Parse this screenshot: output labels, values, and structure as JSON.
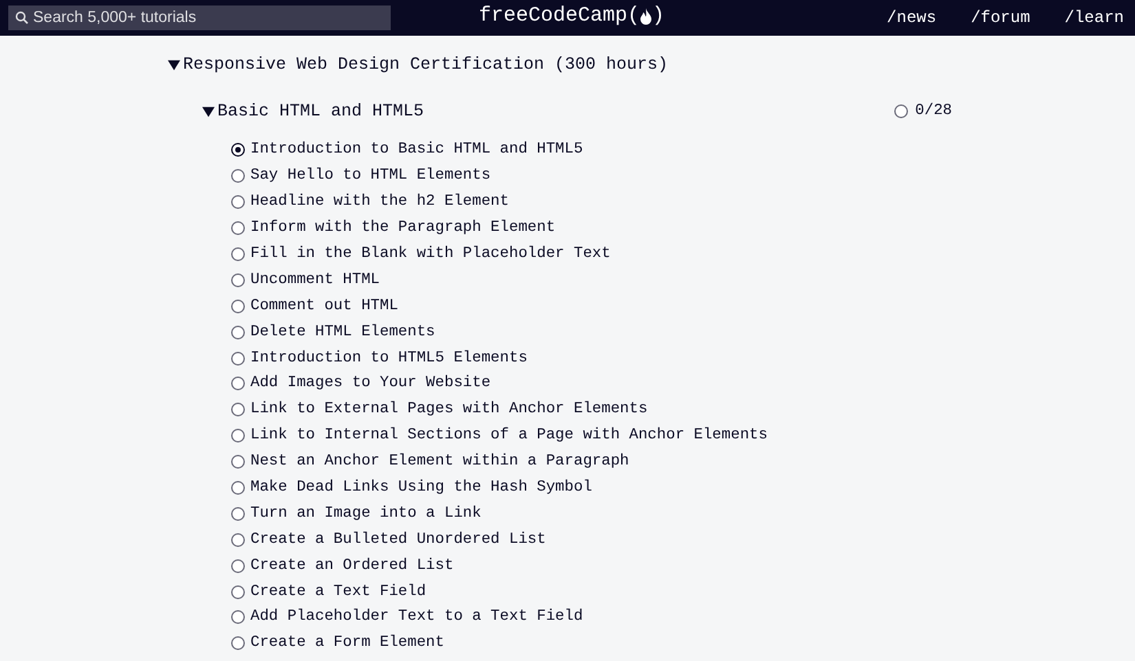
{
  "header": {
    "search": {
      "placeholder": "Search 5,000+ tutorials"
    },
    "logo": {
      "before": "freeCodeCamp(",
      "after": ")"
    },
    "nav": [
      "/news",
      "/forum",
      "/learn"
    ]
  },
  "certification": {
    "title": "Responsive Web Design Certification (300 hours)",
    "expanded": true,
    "block": {
      "title": "Basic HTML and HTML5",
      "expanded": true,
      "completed": false,
      "progress": "0/28",
      "challenges": [
        {
          "title": "Introduction to Basic HTML and HTML5",
          "selected": true
        },
        {
          "title": "Say Hello to HTML Elements",
          "selected": false
        },
        {
          "title": "Headline with the h2 Element",
          "selected": false
        },
        {
          "title": "Inform with the Paragraph Element",
          "selected": false
        },
        {
          "title": "Fill in the Blank with Placeholder Text",
          "selected": false
        },
        {
          "title": "Uncomment HTML",
          "selected": false
        },
        {
          "title": "Comment out HTML",
          "selected": false
        },
        {
          "title": "Delete HTML Elements",
          "selected": false
        },
        {
          "title": "Introduction to HTML5 Elements",
          "selected": false
        },
        {
          "title": "Add Images to Your Website",
          "selected": false
        },
        {
          "title": "Link to External Pages with Anchor Elements",
          "selected": false
        },
        {
          "title": "Link to Internal Sections of a Page with Anchor Elements",
          "selected": false
        },
        {
          "title": "Nest an Anchor Element within a Paragraph",
          "selected": false
        },
        {
          "title": "Make Dead Links Using the Hash Symbol",
          "selected": false
        },
        {
          "title": "Turn an Image into a Link",
          "selected": false
        },
        {
          "title": "Create a Bulleted Unordered List",
          "selected": false
        },
        {
          "title": "Create an Ordered List",
          "selected": false
        },
        {
          "title": "Create a Text Field",
          "selected": false
        },
        {
          "title": "Add Placeholder Text to a Text Field",
          "selected": false
        },
        {
          "title": "Create a Form Element",
          "selected": false
        }
      ]
    }
  }
}
